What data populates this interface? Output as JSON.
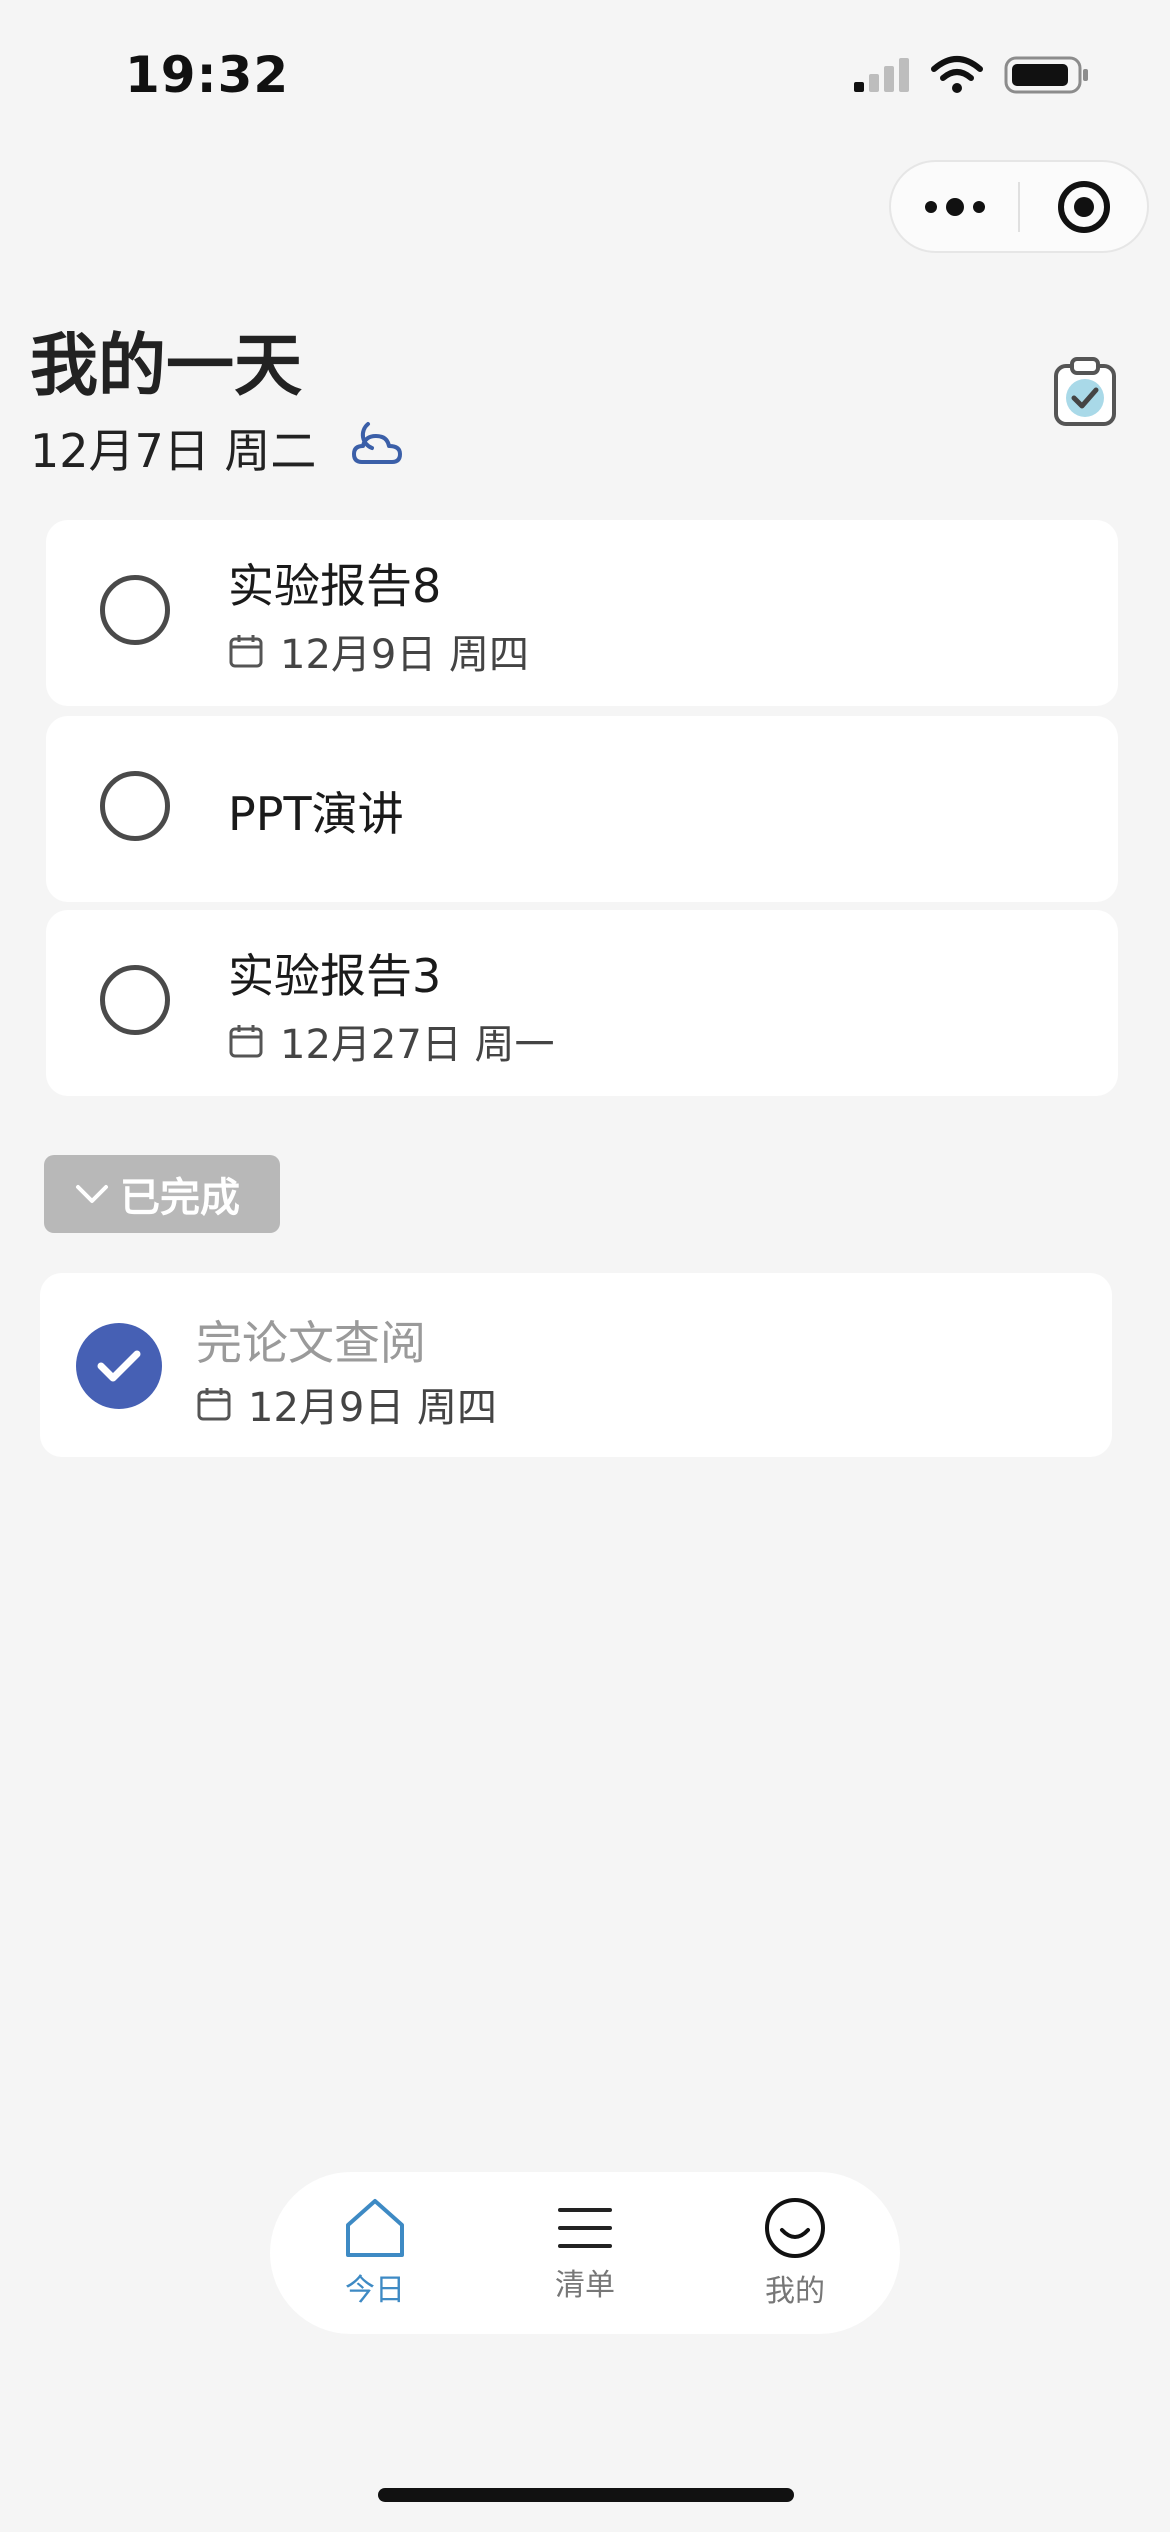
{
  "status_bar": {
    "time": "19:32"
  },
  "header": {
    "title": "我的一天",
    "date": "12月7日 周二"
  },
  "tasks": [
    {
      "title": "实验报告8",
      "due": "12月9日 周四"
    },
    {
      "title": "PPT演讲"
    },
    {
      "title": "实验报告3",
      "due": "12月27日 周一"
    }
  ],
  "completed_section": {
    "toggle_label": "已完成",
    "items": [
      {
        "title": "完论文查阅",
        "due": "12月9日 周四"
      }
    ]
  },
  "tab_bar": {
    "tabs": [
      {
        "label": "今日",
        "icon": "home-icon",
        "active": true
      },
      {
        "label": "清单",
        "icon": "list-icon",
        "active": false
      },
      {
        "label": "我的",
        "icon": "smiley-icon",
        "active": false
      }
    ]
  },
  "colors": {
    "accent_blue": "#4660b4",
    "active_tab": "#3e8ac4",
    "background": "#f5f5f5",
    "done_toggle": "#b8b8b8"
  }
}
